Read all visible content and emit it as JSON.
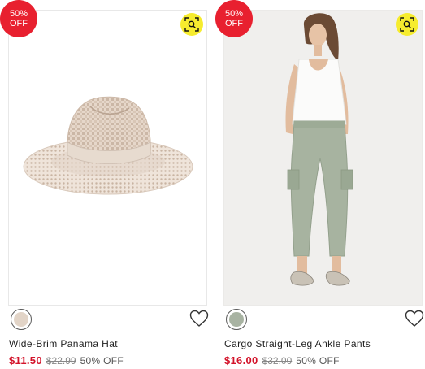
{
  "products": [
    {
      "badge": {
        "line1": "50%",
        "line2": "OFF"
      },
      "swatch_color": "#e2d4c7",
      "name": "Wide-Brim Panama Hat",
      "price": "$11.50",
      "original_price": "$22.99",
      "discount": "50% OFF"
    },
    {
      "badge": {
        "line1": "50%",
        "line2": "OFF"
      },
      "swatch_color": "#a8b3a2",
      "name": "Cargo Straight-Leg Ankle Pants",
      "price": "$16.00",
      "original_price": "$32.00",
      "discount": "50% OFF"
    }
  ],
  "colors": {
    "badge_bg": "#e8202f",
    "scan_button_bg": "#f6ec2e",
    "sale_price": "#d3132a"
  },
  "icons": [
    "image-search-icon",
    "heart-icon"
  ]
}
